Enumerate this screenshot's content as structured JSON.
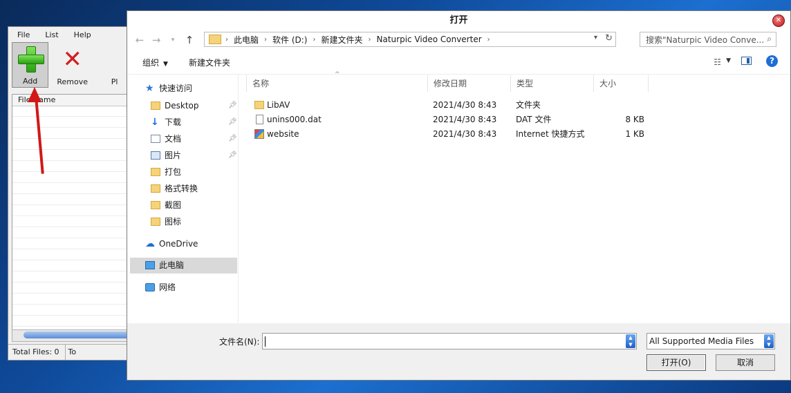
{
  "bg_app": {
    "menu": [
      "File",
      "List",
      "Help"
    ],
    "toolbar": {
      "add": "Add",
      "remove": "Remove",
      "play_partial": "Pl"
    },
    "list_header": "File Name",
    "status": {
      "total_files": "Total Files: 0",
      "total_partial": "To"
    }
  },
  "dialog": {
    "title": "打开",
    "breadcrumbs": [
      "此电脑",
      "软件 (D:)",
      "新建文件夹",
      "Naturpic Video Converter"
    ],
    "search_placeholder": "搜索\"Naturpic Video Conve...",
    "commands": {
      "organize": "组织",
      "new_folder": "新建文件夹"
    },
    "nav": {
      "quick_access": "快速访问",
      "items": [
        "Desktop",
        "下载",
        "文档",
        "图片",
        "打包",
        "格式转换",
        "截图",
        "图标"
      ],
      "onedrive": "OneDrive",
      "this_pc": "此电脑",
      "network": "网络"
    },
    "columns": {
      "name": "名称",
      "modified": "修改日期",
      "type": "类型",
      "size": "大小"
    },
    "files": [
      {
        "name": "LibAV",
        "modified": "2021/4/30 8:43",
        "type": "文件夹",
        "size": "",
        "icon": "folder-icon"
      },
      {
        "name": "unins000.dat",
        "modified": "2021/4/30 8:43",
        "type": "DAT 文件",
        "size": "8 KB",
        "icon": "file-icon"
      },
      {
        "name": "website",
        "modified": "2021/4/30 8:43",
        "type": "Internet 快捷方式",
        "size": "1 KB",
        "icon": "shortcut-icon"
      }
    ],
    "filename_label": "文件名(N):",
    "filename_value": "",
    "filter": "All Supported Media Files",
    "open_button": "打开(O)",
    "cancel_button": "取消"
  },
  "colors": {
    "accent": "#1e6ed6",
    "arrow": "#d01818",
    "folder": "#f5d37a"
  }
}
